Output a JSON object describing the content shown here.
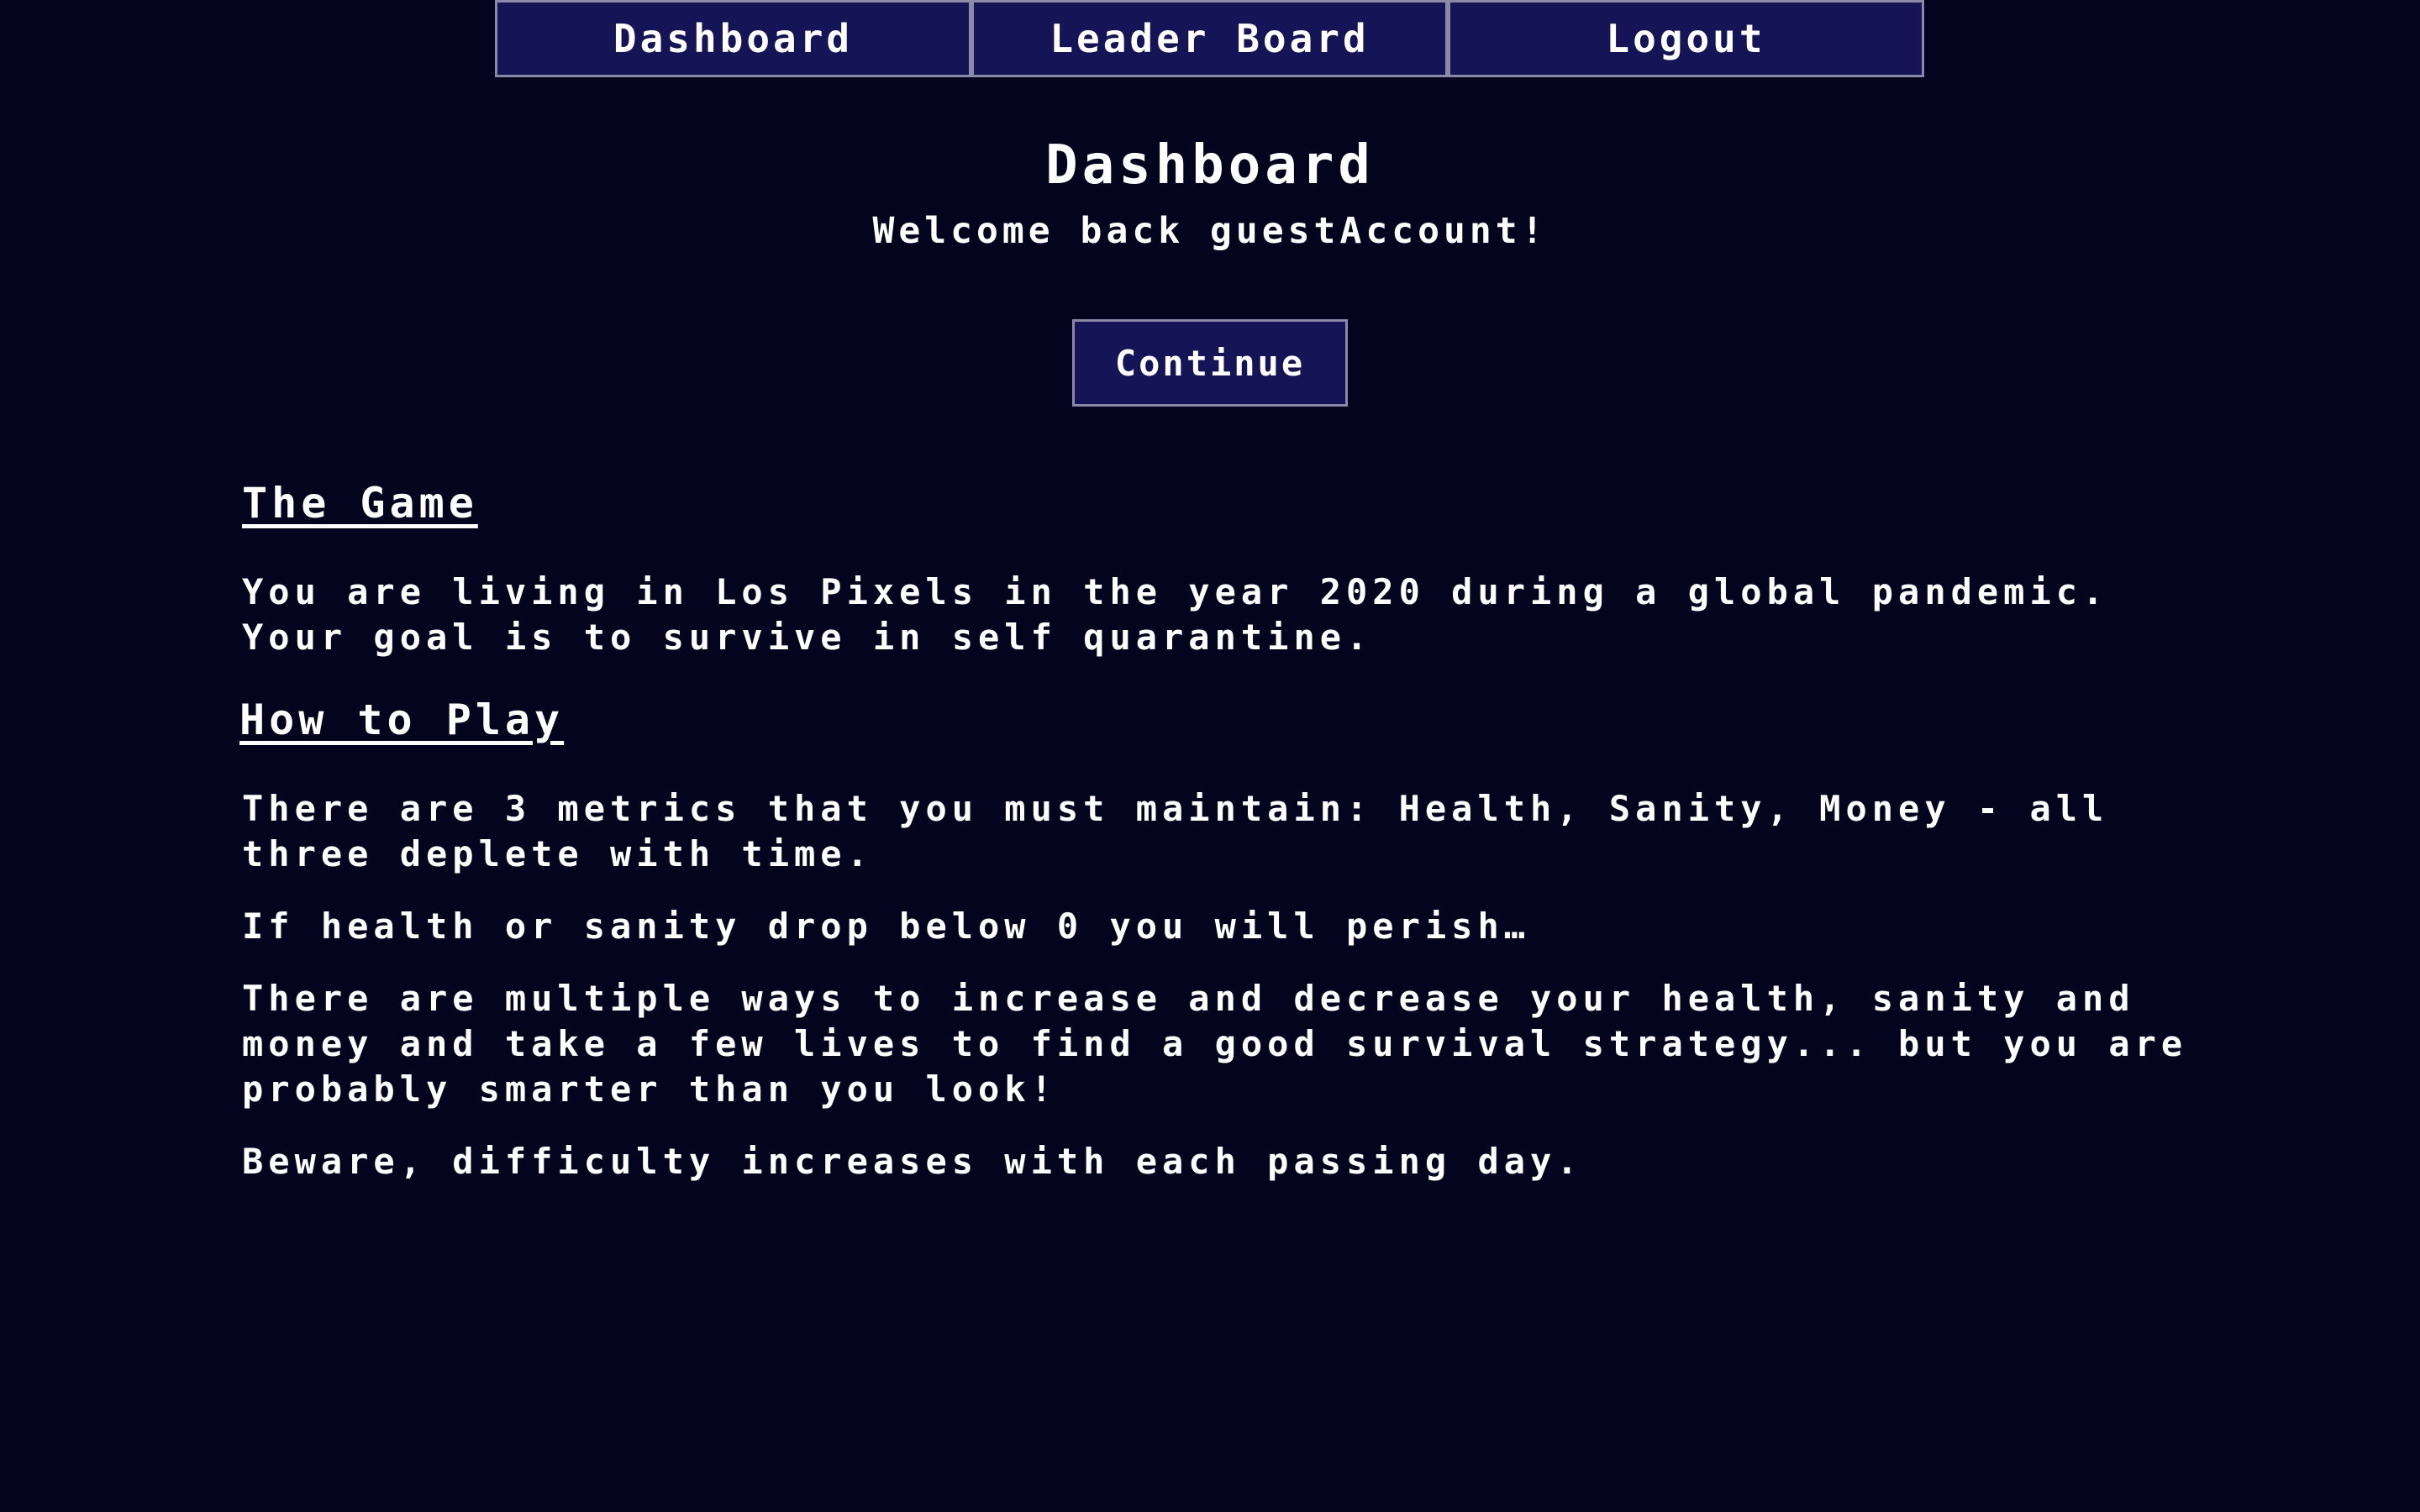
{
  "nav": {
    "dashboard_label": "Dashboard",
    "leaderboard_label": "Leader Board",
    "logout_label": "Logout"
  },
  "header": {
    "title": "Dashboard",
    "welcome": "Welcome back guestAccount!"
  },
  "actions": {
    "continue_label": "Continue"
  },
  "game": {
    "heading": "The Game",
    "description": "You are living in Los Pixels in the year 2020 during a global pandemic. Your goal is to survive in self quarantine."
  },
  "how_to_play": {
    "heading": "How to Play",
    "paragraphs": [
      "There are 3 metrics that you must maintain: Health, Sanity, Money - all three deplete with time.",
      "If health or sanity drop below 0 you will perish…",
      "There are multiple ways to increase and decrease your health, sanity and money and take a few lives to find a good survival strategy... but you are probably smarter than you look!",
      "Beware, difficulty increases with each passing day."
    ]
  },
  "colors": {
    "background": "#05041f",
    "button_bg": "#151456",
    "button_border": "#8a8aa8",
    "text": "#ffffff"
  }
}
